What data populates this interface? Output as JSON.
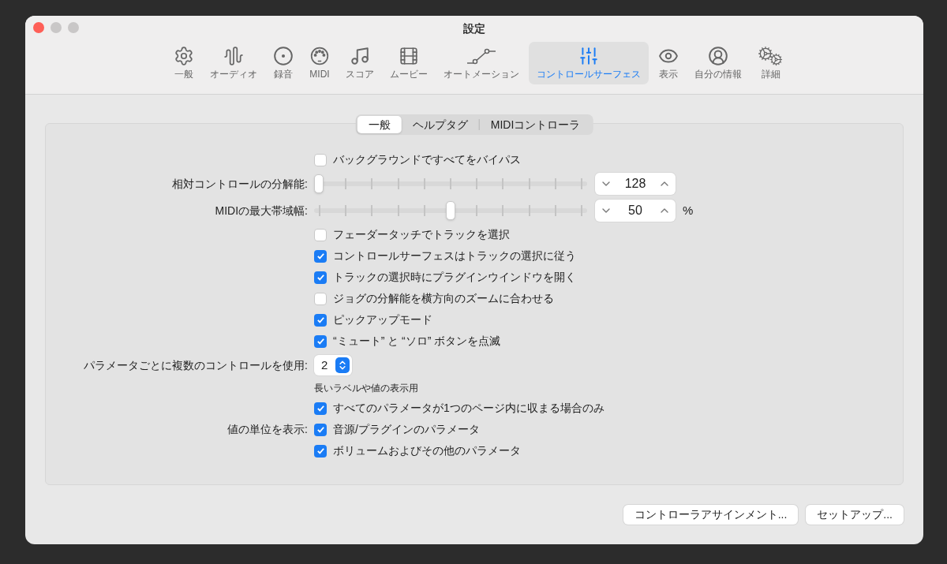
{
  "window": {
    "title": "設定"
  },
  "toolbar": [
    {
      "label": "一般",
      "selected": false
    },
    {
      "label": "オーディオ",
      "selected": false
    },
    {
      "label": "録音",
      "selected": false
    },
    {
      "label": "MIDI",
      "selected": false
    },
    {
      "label": "スコア",
      "selected": false
    },
    {
      "label": "ムービー",
      "selected": false
    },
    {
      "label": "オートメーション",
      "selected": false
    },
    {
      "label": "コントロールサーフェス",
      "selected": true
    },
    {
      "label": "表示",
      "selected": false
    },
    {
      "label": "自分の情報",
      "selected": false
    },
    {
      "label": "詳細",
      "selected": false
    }
  ],
  "tabs": [
    {
      "label": "一般",
      "selected": true
    },
    {
      "label": "ヘルプタグ",
      "selected": false
    },
    {
      "label": "MIDIコントローラ",
      "selected": false
    }
  ],
  "rows": [
    {
      "kind": "checkbox",
      "text": "バックグラウンドですべてをバイパス",
      "checked": false
    },
    {
      "kind": "slider",
      "label": "相対コントロールの分解能:",
      "level": 0,
      "value": "128"
    },
    {
      "kind": "slider",
      "label": "MIDIの最大帯域幅:",
      "level": 0.5,
      "value": "50",
      "unit": "%"
    },
    {
      "kind": "checkbox",
      "text": "フェーダータッチでトラックを選択",
      "checked": false
    },
    {
      "kind": "checkbox",
      "text": "コントロールサーフェスはトラックの選択に従う",
      "checked": true
    },
    {
      "kind": "checkbox",
      "text": "トラックの選択時にプラグインウインドウを開く",
      "checked": true
    },
    {
      "kind": "checkbox",
      "text": "ジョグの分解能を横方向のズームに合わせる",
      "checked": false
    },
    {
      "kind": "checkbox",
      "text": "ピックアップモード",
      "checked": true
    },
    {
      "kind": "checkbox",
      "text": "“ミュート” と “ソロ” ボタンを点滅",
      "checked": true
    },
    {
      "kind": "popup",
      "label": "パラメータごとに複数のコントロールを使用:",
      "value": "2"
    },
    {
      "kind": "note",
      "text": "長いラベルや値の表示用"
    },
    {
      "kind": "checkbox",
      "text": "すべてのパラメータが1つのページ内に収まる場合のみ",
      "checked": true
    },
    {
      "kind": "checkbox",
      "label": "値の単位を表示:",
      "text": "音源/プラグインのパラメータ",
      "checked": true
    },
    {
      "kind": "checkbox",
      "text": "ボリュームおよびその他のパラメータ",
      "checked": true
    }
  ],
  "buttons": [
    "コントローラアサインメント...",
    "セットアップ..."
  ]
}
